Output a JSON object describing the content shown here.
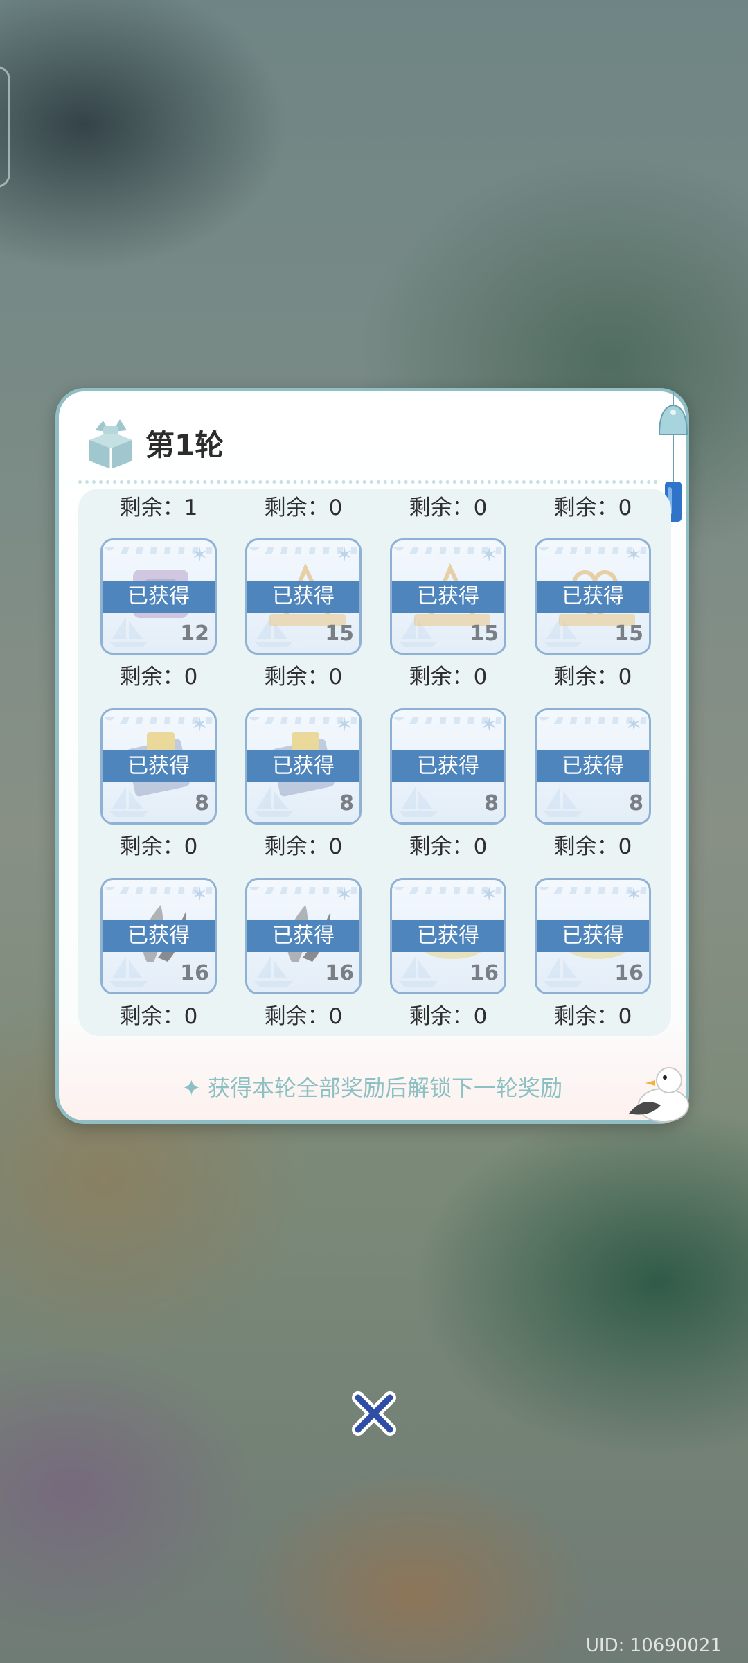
{
  "round_title": "第1轮",
  "top_remaining": [
    "剩余：1",
    "剩余：0",
    "剩余：0",
    "剩余：0"
  ],
  "rows": [
    {
      "cards": [
        {
          "status": "已获得",
          "qty": "12",
          "item": "chip-box"
        },
        {
          "status": "已获得",
          "qty": "15",
          "item": "triangle-frame"
        },
        {
          "status": "已获得",
          "qty": "15",
          "item": "triangle-frame"
        },
        {
          "status": "已获得",
          "qty": "15",
          "item": "heart-frame"
        }
      ],
      "remaining": [
        "剩余：0",
        "剩余：0",
        "剩余：0",
        "剩余：0"
      ]
    },
    {
      "cards": [
        {
          "status": "已获得",
          "qty": "8",
          "item": "document-folder"
        },
        {
          "status": "已获得",
          "qty": "8",
          "item": "document-folder"
        },
        {
          "status": "已获得",
          "qty": "8",
          "item": "glasses"
        },
        {
          "status": "已获得",
          "qty": "8",
          "item": "glasses"
        }
      ],
      "remaining": [
        "剩余：0",
        "剩余：0",
        "剩余：0",
        "剩余：0"
      ]
    },
    {
      "cards": [
        {
          "status": "已获得",
          "qty": "16",
          "item": "feather-charm"
        },
        {
          "status": "已获得",
          "qty": "16",
          "item": "feather-charm"
        },
        {
          "status": "已获得",
          "qty": "16",
          "item": "plate"
        },
        {
          "status": "已获得",
          "qty": "16",
          "item": "plate"
        }
      ],
      "remaining": [
        "剩余：0",
        "剩余：0",
        "剩余：0",
        "剩余：0"
      ]
    }
  ],
  "footer_hint": "✦ 获得本轮全部奖励后解锁下一轮奖励",
  "uid": "UID: 10690021",
  "colors": {
    "band": "#4f85bd",
    "panel_border": "#8fbfc4",
    "hint": "#8cc0c2",
    "close_icon": "#2f4fa6"
  },
  "icons": [
    "gift-box-icon",
    "wind-chime-icon",
    "seagull-icon",
    "close-icon"
  ]
}
